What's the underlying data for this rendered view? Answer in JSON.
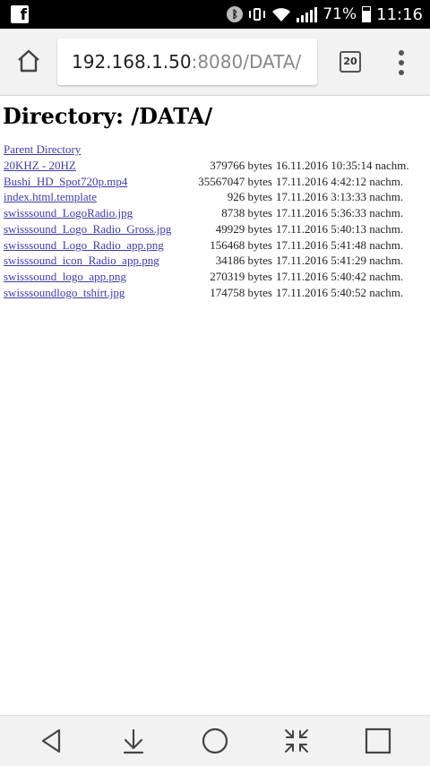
{
  "status_bar": {
    "battery": "71%",
    "time": "11:16",
    "icons": [
      "facebook-icon",
      "bluetooth-icon",
      "vibrate-icon",
      "wifi-icon",
      "signal-icon",
      "battery-icon"
    ]
  },
  "browser": {
    "url_host": "192.168.1.50",
    "url_rest": ":8080/DATA/",
    "tab_count": "20"
  },
  "page": {
    "title": "Directory: /DATA/",
    "parent_label": "Parent Directory",
    "files": [
      {
        "name": "20KHZ - 20HZ",
        "size": "379766 bytes",
        "date": "16.11.2016 10:35:14 nachm."
      },
      {
        "name": "Bushi_HD_Spot720p.mp4",
        "size": "35567047 bytes",
        "date": "17.11.2016 4:42:12 nachm."
      },
      {
        "name": "index.html.template",
        "size": "926 bytes",
        "date": "17.11.2016 3:13:33 nachm."
      },
      {
        "name": "swisssound_LogoRadio.jpg",
        "size": "8738 bytes",
        "date": "17.11.2016 5:36:33 nachm."
      },
      {
        "name": "swisssound_Logo_Radio_Gross.jpg",
        "size": "49929 bytes",
        "date": "17.11.2016 5:40:13 nachm."
      },
      {
        "name": "swisssound_Logo_Radio_app.png",
        "size": "156468 bytes",
        "date": "17.11.2016 5:41:48 nachm."
      },
      {
        "name": "swisssound_icon_Radio_app.png",
        "size": "34186 bytes",
        "date": "17.11.2016 5:41:29 nachm."
      },
      {
        "name": "swisssound_logo_app.png",
        "size": "270319 bytes",
        "date": "17.11.2016 5:40:42 nachm."
      },
      {
        "name": "swisssoundlogo_tshirt.jpg",
        "size": "174758 bytes",
        "date": "17.11.2016 5:40:52 nachm."
      }
    ]
  },
  "nav_bar": {
    "buttons": [
      "back-icon",
      "download-icon",
      "home-circle-icon",
      "collapse-icon",
      "recents-icon"
    ]
  }
}
